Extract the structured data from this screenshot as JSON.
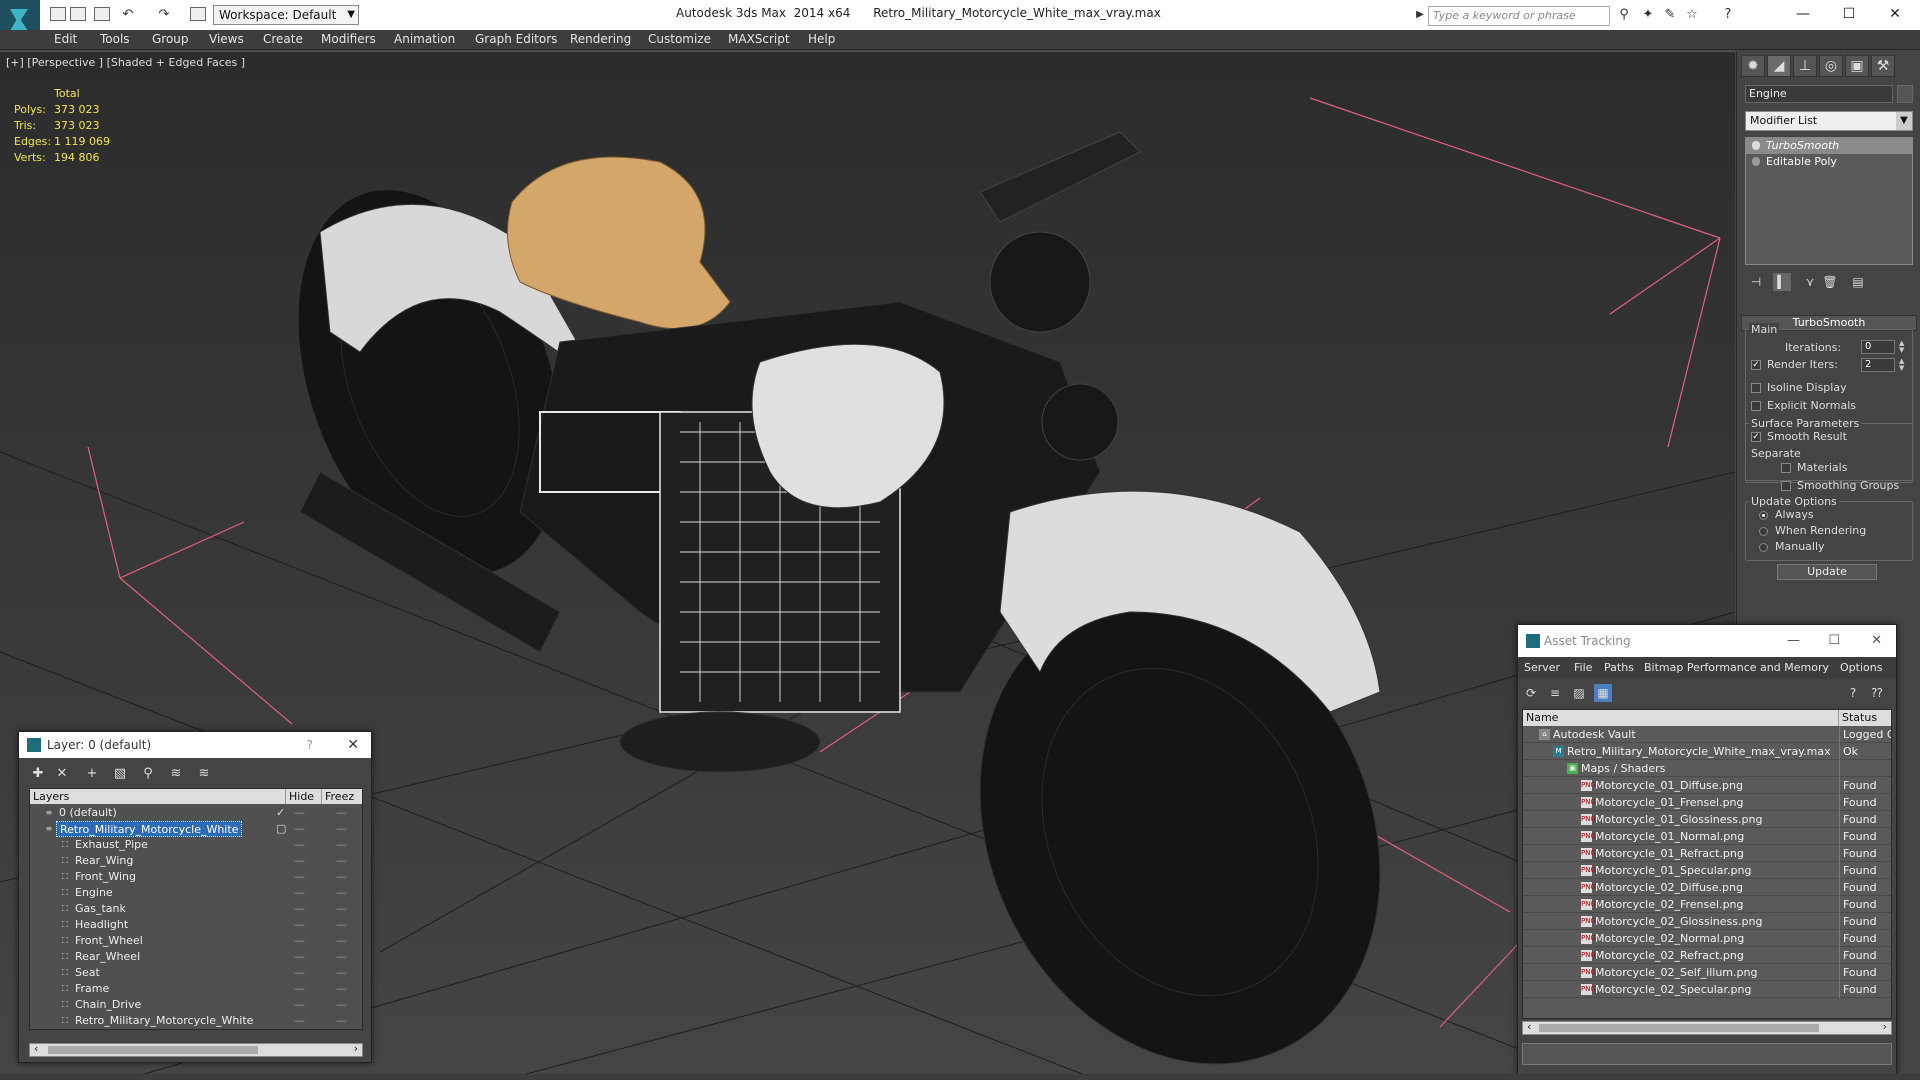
{
  "window": {
    "title": "Autodesk 3ds Max  2014 x64      Retro_Military_Motorcycle_White_max_vray.max",
    "workspace_label": "Workspace: Default",
    "search_placeholder": "Type a keyword or phrase"
  },
  "menu": [
    "Edit",
    "Tools",
    "Group",
    "Views",
    "Create",
    "Modifiers",
    "Animation",
    "Graph Editors",
    "Rendering",
    "Customize",
    "MAXScript",
    "Help"
  ],
  "viewport": {
    "label": "[+] [Perspective ] [Shaded + Edged Faces ]",
    "stats": {
      "header": "Total",
      "rows": [
        {
          "k": "Polys:",
          "v": "373 023"
        },
        {
          "k": "Tris:",
          "v": "373 023"
        },
        {
          "k": "Edges:",
          "v": "1 119 069"
        },
        {
          "k": "Verts:",
          "v": "194 806"
        }
      ]
    }
  },
  "command_panel": {
    "object_name": "Engine",
    "modifier_list": "Modifier List",
    "stack": [
      "TurboSmooth",
      "Editable Poly"
    ],
    "rollout_title": "TurboSmooth",
    "main_label": "Main",
    "iterations_label": "Iterations:",
    "iterations_value": "0",
    "render_iters_label": "Render Iters:",
    "render_iters_value": "2",
    "render_iters_checked": true,
    "isoline_label": "Isoline Display",
    "explicit_normals_label": "Explicit Normals",
    "surface_params_label": "Surface Parameters",
    "smooth_result_label": "Smooth Result",
    "separate_label": "Separate",
    "materials_label": "Materials",
    "smoothing_groups_label": "Smoothing Groups",
    "update_options_label": "Update Options",
    "update_always": "Always",
    "update_rendering": "When Rendering",
    "update_manually": "Manually",
    "update_button": "Update"
  },
  "layer_dialog": {
    "title": "Layer: 0 (default)",
    "help": "?",
    "columns": [
      "Layers",
      "Hide",
      "Freez"
    ],
    "rows": [
      {
        "name": "0 (default)",
        "indent": 0,
        "icon": "layer",
        "selected": false,
        "check": true
      },
      {
        "name": "Retro_Military_Motorcycle_White",
        "indent": 0,
        "icon": "layer",
        "selected": true,
        "check": false
      },
      {
        "name": "Exhaust_Pipe",
        "indent": 1,
        "icon": "object"
      },
      {
        "name": "Rear_Wing",
        "indent": 1,
        "icon": "object"
      },
      {
        "name": "Front_Wing",
        "indent": 1,
        "icon": "object"
      },
      {
        "name": "Engine",
        "indent": 1,
        "icon": "object"
      },
      {
        "name": "Gas_tank",
        "indent": 1,
        "icon": "object"
      },
      {
        "name": "Headlight",
        "indent": 1,
        "icon": "object"
      },
      {
        "name": "Front_Wheel",
        "indent": 1,
        "icon": "object"
      },
      {
        "name": "Rear_Wheel",
        "indent": 1,
        "icon": "object"
      },
      {
        "name": "Seat",
        "indent": 1,
        "icon": "object"
      },
      {
        "name": "Frame",
        "indent": 1,
        "icon": "object"
      },
      {
        "name": "Chain_Drive",
        "indent": 1,
        "icon": "object"
      },
      {
        "name": "Retro_Military_Motorcycle_White",
        "indent": 1,
        "icon": "object"
      }
    ]
  },
  "asset_dialog": {
    "title": "Asset Tracking",
    "menu": [
      "Server",
      "File",
      "Paths",
      "Bitmap Performance and Memory",
      "Options"
    ],
    "columns": [
      "Name",
      "Status"
    ],
    "rows": [
      {
        "name": "Autodesk Vault",
        "status": "Logged Out",
        "indent": 0,
        "icon": "vault"
      },
      {
        "name": "Retro_Military_Motorcycle_White_max_vray.max",
        "status": "Ok",
        "indent": 1,
        "icon": "max"
      },
      {
        "name": "Maps / Shaders",
        "status": "",
        "indent": 2,
        "icon": "maps"
      },
      {
        "name": "Motorcycle_01_Diffuse.png",
        "status": "Found",
        "indent": 3,
        "icon": "png"
      },
      {
        "name": "Motorcycle_01_Frensel.png",
        "status": "Found",
        "indent": 3,
        "icon": "png"
      },
      {
        "name": "Motorcycle_01_Glossiness.png",
        "status": "Found",
        "indent": 3,
        "icon": "png"
      },
      {
        "name": "Motorcycle_01_Normal.png",
        "status": "Found",
        "indent": 3,
        "icon": "png"
      },
      {
        "name": "Motorcycle_01_Refract.png",
        "status": "Found",
        "indent": 3,
        "icon": "png"
      },
      {
        "name": "Motorcycle_01_Specular.png",
        "status": "Found",
        "indent": 3,
        "icon": "png"
      },
      {
        "name": "Motorcycle_02_Diffuse.png",
        "status": "Found",
        "indent": 3,
        "icon": "png"
      },
      {
        "name": "Motorcycle_02_Frensel.png",
        "status": "Found",
        "indent": 3,
        "icon": "png"
      },
      {
        "name": "Motorcycle_02_Glossiness.png",
        "status": "Found",
        "indent": 3,
        "icon": "png"
      },
      {
        "name": "Motorcycle_02_Normal.png",
        "status": "Found",
        "indent": 3,
        "icon": "png"
      },
      {
        "name": "Motorcycle_02_Refract.png",
        "status": "Found",
        "indent": 3,
        "icon": "png"
      },
      {
        "name": "Motorcycle_02_Self_illum.png",
        "status": "Found",
        "indent": 3,
        "icon": "png"
      },
      {
        "name": "Motorcycle_02_Specular.png",
        "status": "Found",
        "indent": 3,
        "icon": "png"
      }
    ]
  },
  "colors": {
    "viewport_bg": "#333333",
    "stats_text": "#f2e64a",
    "selection": "#2d6ab5",
    "seat": "#d4a66a"
  }
}
